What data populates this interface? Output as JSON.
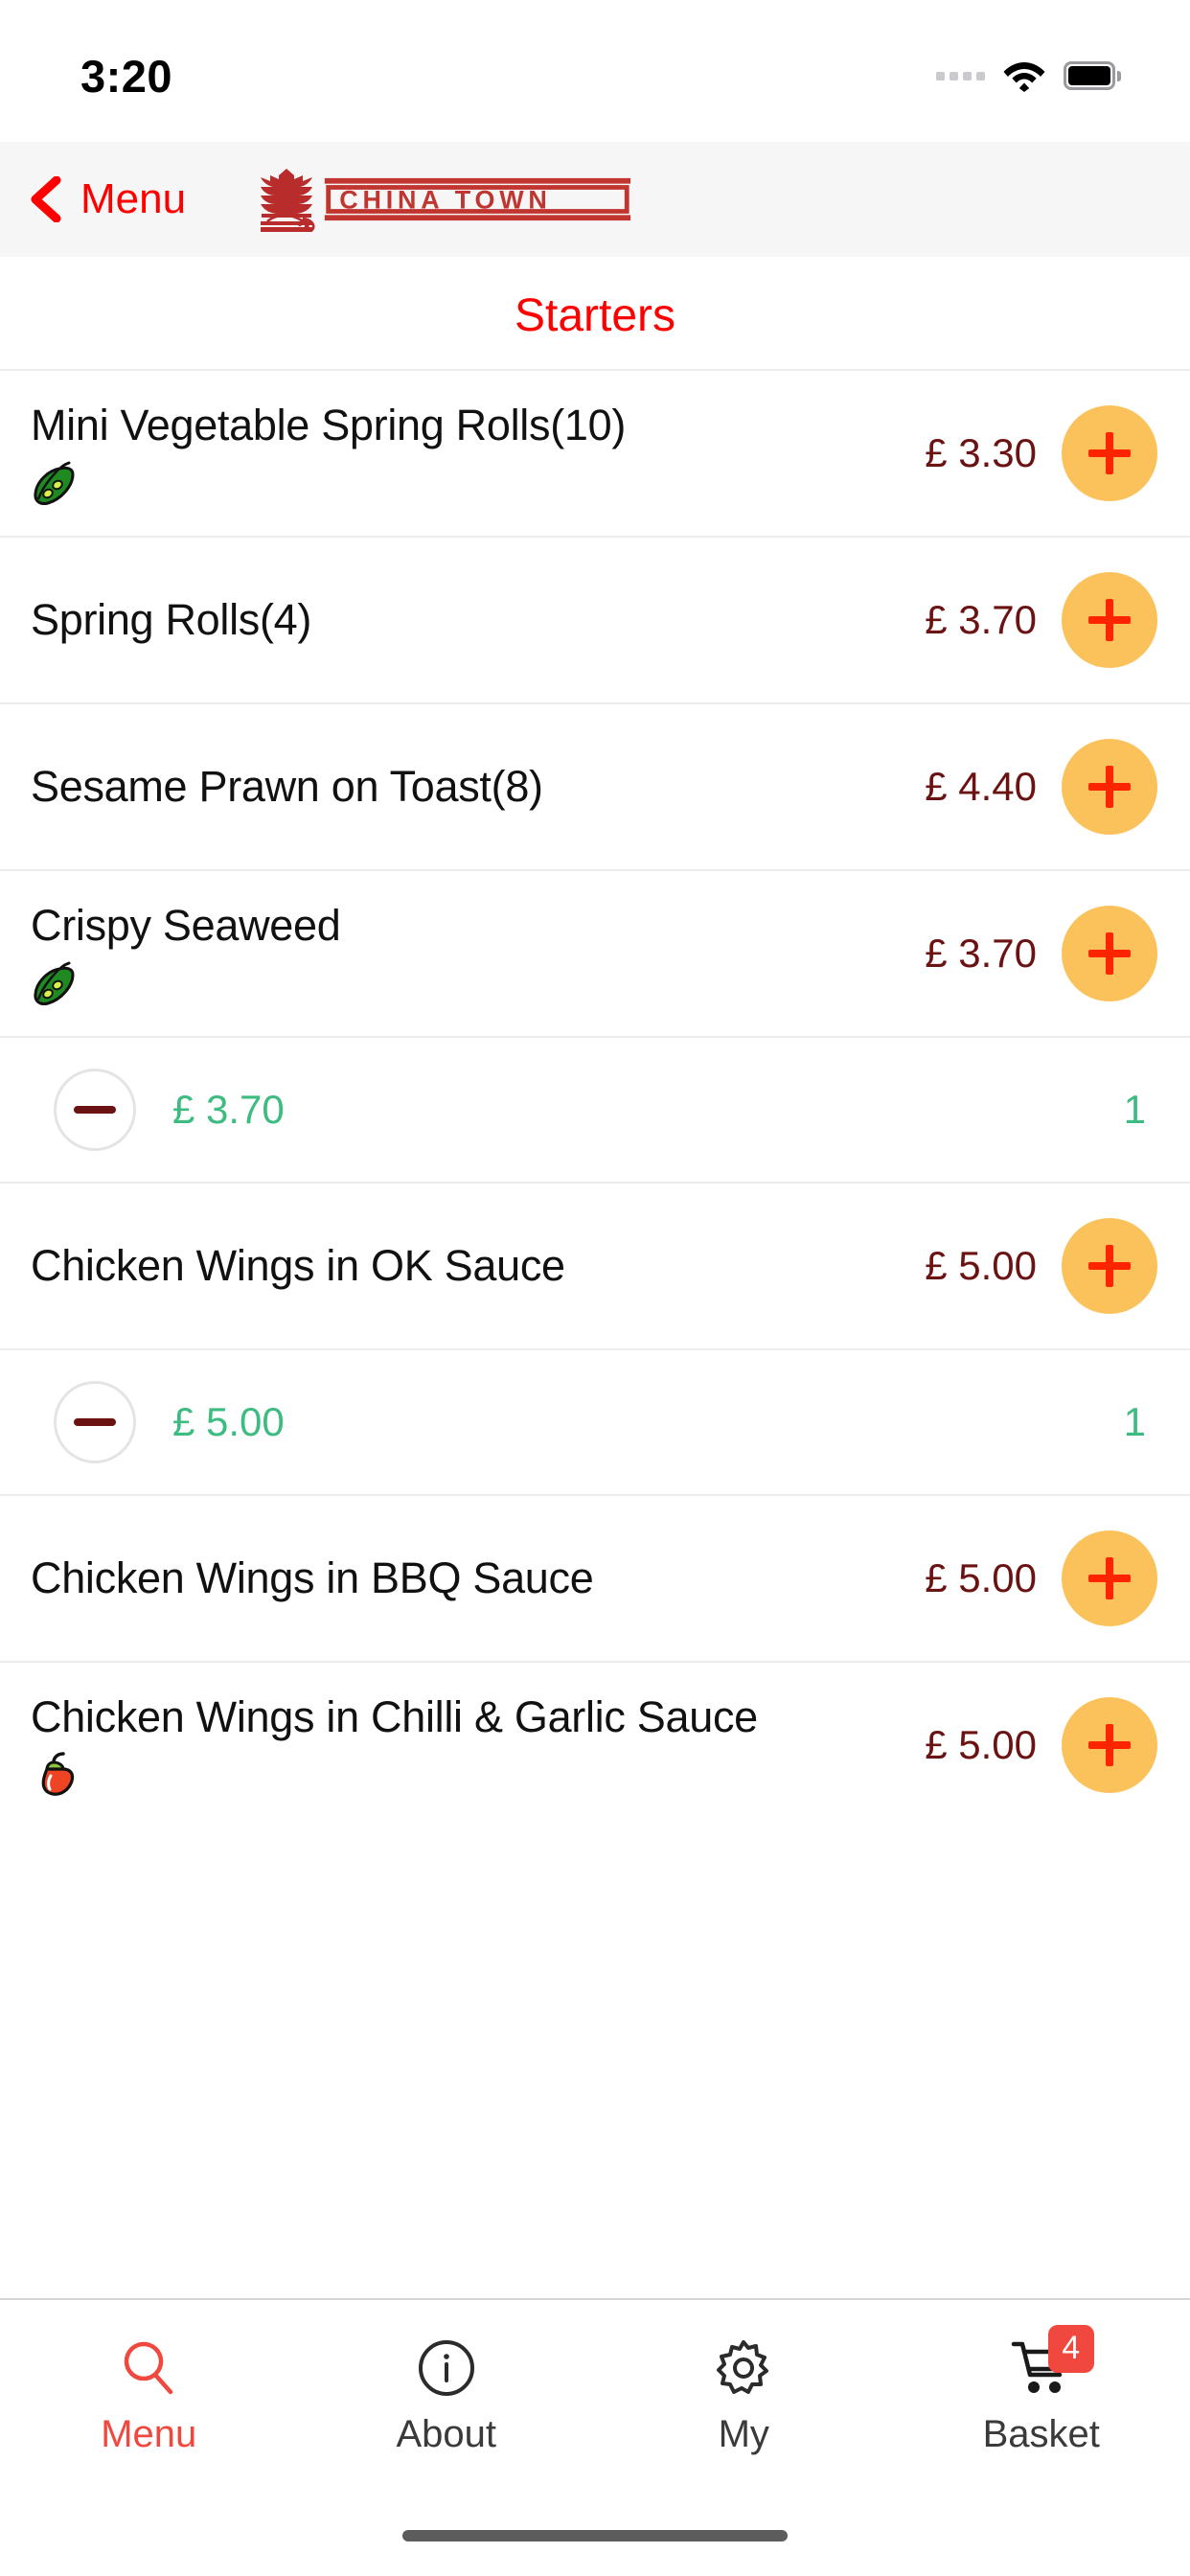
{
  "status_bar": {
    "time": "3:20",
    "signal_icon": "signal-dots-icon",
    "wifi_icon": "wifi-icon",
    "battery_icon": "battery-icon"
  },
  "nav": {
    "back_label": "Menu",
    "back_icon": "chevron-left-icon",
    "logo_mark": "pagoda-logo-icon",
    "logo_text": "CHINA TOWN",
    "logo_subtext": "CHINA TOWN"
  },
  "section": {
    "title": "Starters"
  },
  "colors": {
    "accent_red": "#fe0000",
    "price_maroon": "#6b1313",
    "add_button": "#fbc25b",
    "qty_green": "#3cbc81",
    "tab_active": "#f0483e",
    "logo_red": "#b92c2c"
  },
  "menu_items": [
    {
      "name": "Mini Vegetable Spring Rolls(10)",
      "price": "£ 3.30",
      "diet": "vegetarian",
      "add_label": "+",
      "quantity": null,
      "quantity_price": null
    },
    {
      "name": "Spring Rolls(4)",
      "price": "£ 3.70",
      "diet": null,
      "add_label": "+",
      "quantity": null,
      "quantity_price": null
    },
    {
      "name": "Sesame Prawn on Toast(8)",
      "price": "£ 4.40",
      "diet": null,
      "add_label": "+",
      "quantity": null,
      "quantity_price": null
    },
    {
      "name": "Crispy Seaweed",
      "price": "£ 3.70",
      "diet": "vegetarian",
      "add_label": "+",
      "quantity": "1",
      "quantity_price": "£ 3.70"
    },
    {
      "name": "Chicken Wings in OK Sauce",
      "price": "£ 5.00",
      "diet": null,
      "add_label": "+",
      "quantity": "1",
      "quantity_price": "£ 5.00"
    },
    {
      "name": "Chicken Wings in BBQ Sauce",
      "price": "£ 5.00",
      "diet": null,
      "add_label": "+",
      "quantity": null,
      "quantity_price": null
    },
    {
      "name": "Chicken Wings in Chilli & Garlic Sauce",
      "price": "£ 5.00",
      "diet": "spicy",
      "add_label": "+",
      "quantity": null,
      "quantity_price": null
    }
  ],
  "tabs": [
    {
      "label": "Menu",
      "icon": "search-icon",
      "active": true,
      "badge": null
    },
    {
      "label": "About",
      "icon": "info-circle-icon",
      "active": false,
      "badge": null
    },
    {
      "label": "My",
      "icon": "gear-icon",
      "active": false,
      "badge": null
    },
    {
      "label": "Basket",
      "icon": "shopping-cart-icon",
      "active": false,
      "badge": "4"
    }
  ]
}
